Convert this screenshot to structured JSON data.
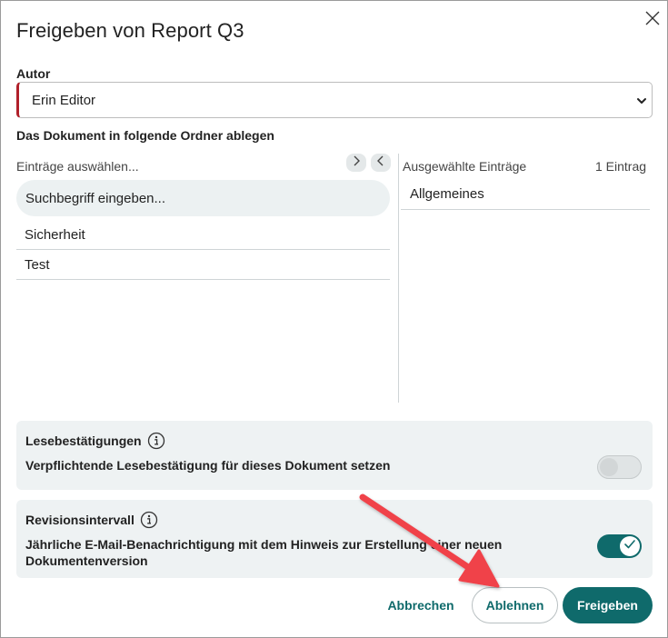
{
  "dialog": {
    "title": "Freigeben von Report Q3"
  },
  "author": {
    "label": "Autor",
    "selected": "Erin Editor"
  },
  "folders": {
    "label": "Das Dokument in folgende Ordner ablegen",
    "available": {
      "header": "Einträge auswählen...",
      "search_placeholder": "Suchbegriff eingeben...",
      "items": [
        "Sicherheit",
        "Test"
      ]
    },
    "selected": {
      "header": "Ausgewählte Einträge",
      "count": "1 Eintrag",
      "items": [
        "Allgemeines"
      ]
    }
  },
  "read_receipts": {
    "title": "Lesebestätigungen",
    "description": "Verpflichtende Lesebestätigung für dieses Dokument setzen",
    "enabled": false
  },
  "revision": {
    "title": "Revisionsintervall",
    "description": "Jährliche E-Mail-Benachrichtigung mit dem Hinweis zur Erstellung einer neuen Dokumentenversion",
    "enabled": true
  },
  "buttons": {
    "cancel": "Abbrechen",
    "reject": "Ablehnen",
    "share": "Freigeben"
  },
  "colors": {
    "accent": "#0f6a6b",
    "required_marker": "#b0202a",
    "annotation_arrow": "#f0424a"
  },
  "icons": {
    "close": "close-icon",
    "move_right": "chevron-right-icon",
    "move_left": "chevron-left-icon",
    "info": "info-icon",
    "dropdown": "chevron-down-icon",
    "check": "check-icon"
  }
}
